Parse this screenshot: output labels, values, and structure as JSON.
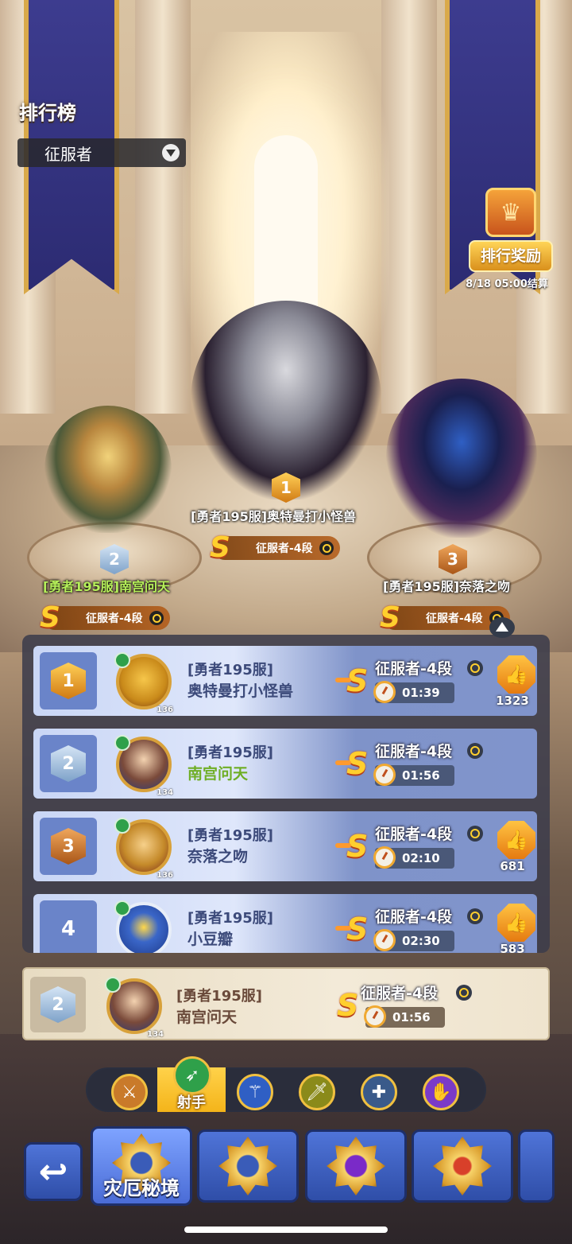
{
  "header": {
    "title": "排行榜",
    "filter_value": "征服者"
  },
  "reward": {
    "button_label": "排行奖励",
    "settle_time": "8/18 05:00结算"
  },
  "podium": [
    {
      "rank": "1",
      "name": "[勇者195服]奥特曼打小怪兽",
      "tier": "征服者-4段"
    },
    {
      "rank": "2",
      "name": "[勇者195服]南宫问天",
      "tier": "征服者-4段"
    },
    {
      "rank": "3",
      "name": "[勇者195服]奈落之吻",
      "tier": "征服者-4段"
    }
  ],
  "leaderboard": {
    "rows": [
      {
        "rank": "1",
        "server": "[勇者195服]",
        "name": "奥特曼打小怪兽",
        "level": "136",
        "tier": "征服者-4段",
        "time": "01:39",
        "likes": "1323"
      },
      {
        "rank": "2",
        "server": "[勇者195服]",
        "name": "南宫问天",
        "level": "134",
        "tier": "征服者-4段",
        "time": "01:56",
        "likes": ""
      },
      {
        "rank": "3",
        "server": "[勇者195服]",
        "name": "奈落之吻",
        "level": "136",
        "tier": "征服者-4段",
        "time": "02:10",
        "likes": "681"
      },
      {
        "rank": "4",
        "server": "[勇者195服]",
        "name": "小豆瓣",
        "level": "",
        "tier": "征服者-4段",
        "time": "02:30",
        "likes": "583"
      }
    ]
  },
  "my_rank": {
    "rank": "2",
    "server": "[勇者195服]",
    "name": "南宫问天",
    "level": "134",
    "tier": "征服者-4段",
    "time": "01:56"
  },
  "class_tabs": {
    "active_label": "射手",
    "icons": [
      "axe-icon",
      "bow-icon",
      "staff-icon",
      "sword-icon",
      "cross-icon",
      "magic-hand-icon"
    ]
  },
  "bottom_nav": {
    "active_label": "灾厄秘境"
  },
  "colors": {
    "accent_gold": "#f4b41a",
    "row_blue": "#7f93c9",
    "name_green": "#6fae25"
  }
}
